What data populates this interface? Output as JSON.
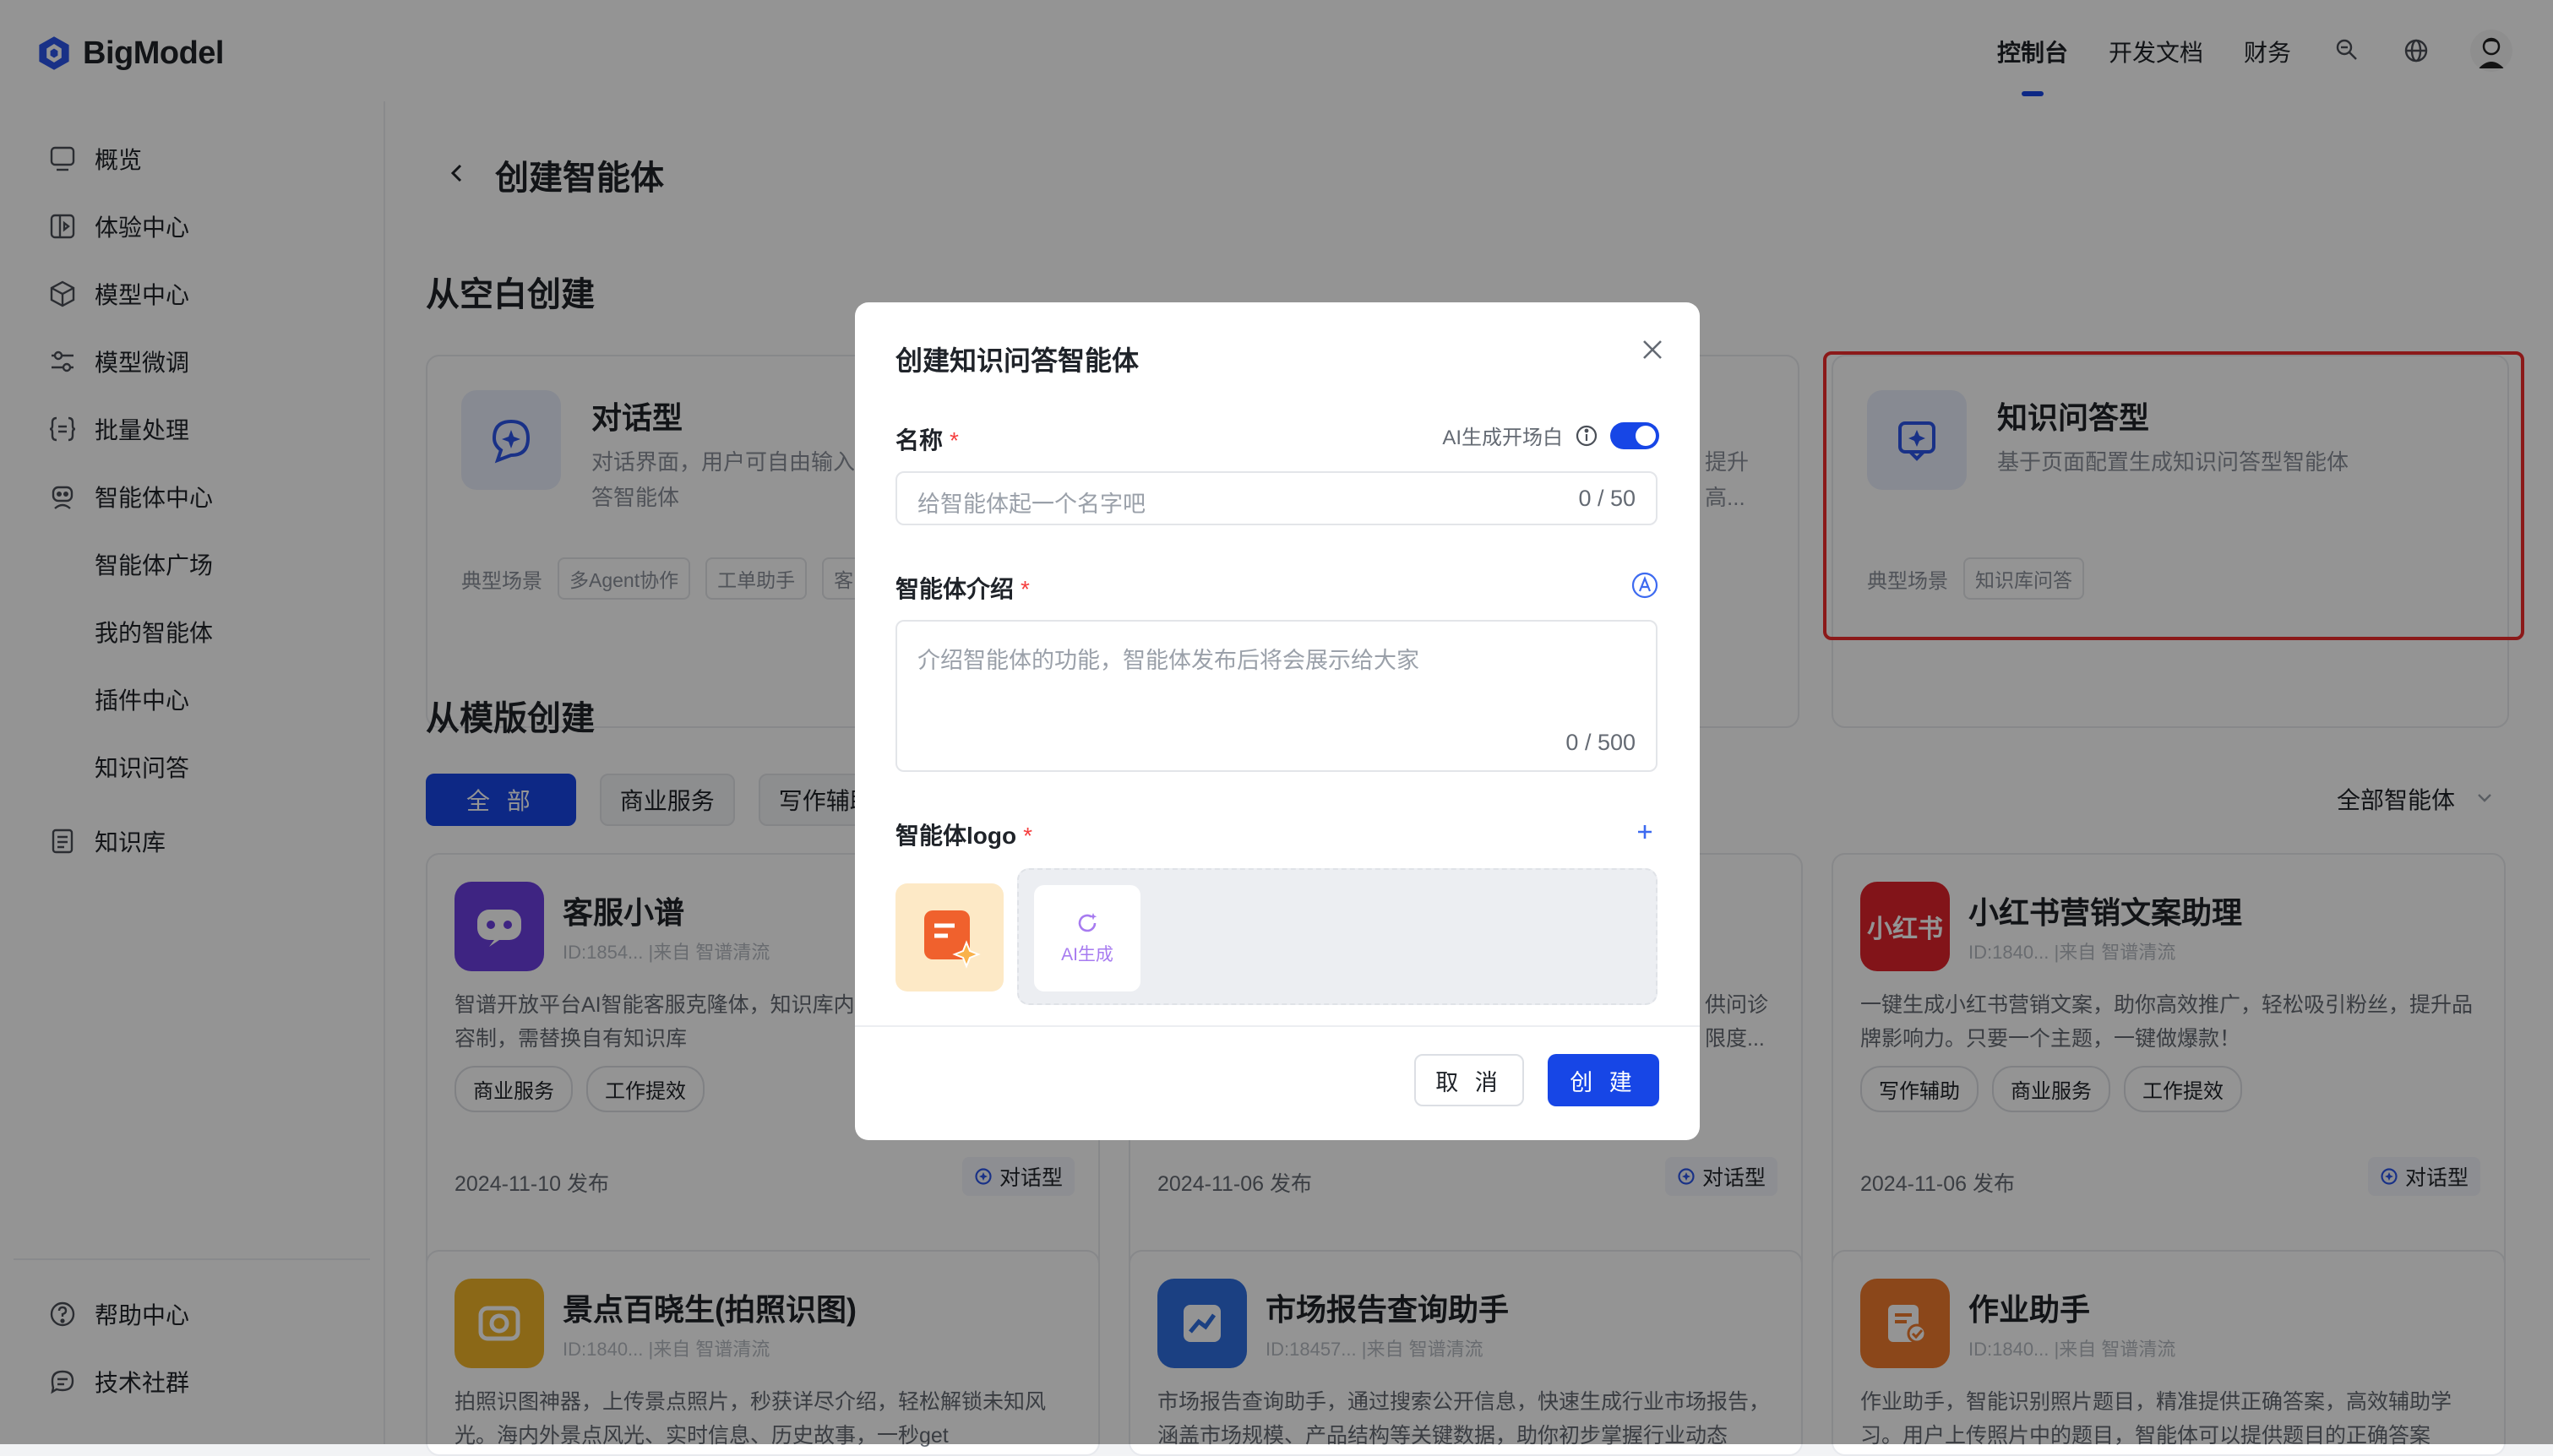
{
  "app": {
    "logo_text": "BigModel"
  },
  "topnav": {
    "items": [
      "控制台",
      "开发文档",
      "财务"
    ],
    "icons": [
      "service-icon",
      "globe-icon",
      "user-avatar"
    ]
  },
  "sidebar": {
    "items": [
      {
        "label": "概览",
        "icon": "overview-icon"
      },
      {
        "label": "体验中心",
        "icon": "experience-icon"
      },
      {
        "label": "模型中心",
        "icon": "cube-icon"
      },
      {
        "label": "模型微调",
        "icon": "sliders-icon"
      },
      {
        "label": "批量处理",
        "icon": "braces-icon"
      },
      {
        "label": "智能体中心",
        "icon": "robot-icon"
      }
    ],
    "sub_items": [
      "智能体广场",
      "我的智能体",
      "插件中心",
      "知识问答"
    ],
    "knowledge": {
      "label": "知识库",
      "icon": "book-icon"
    },
    "bottom": [
      {
        "label": "帮助中心",
        "icon": "help-icon"
      },
      {
        "label": "技术社群",
        "icon": "chat-icon"
      }
    ]
  },
  "page": {
    "title": "创建智能体",
    "blank_section": "从空白创建",
    "template_section": "从模版创建"
  },
  "blank_cards": [
    {
      "title": "对话型",
      "desc": "对话界面，用户可自由输入问答智能体",
      "scene_label": "典型场景",
      "tags": [
        "多Agent协作",
        "工单助手",
        "客"
      ]
    },
    {
      "title": "",
      "desc": "提升高...",
      "scene_label": "",
      "tags": []
    },
    {
      "title": "知识问答型",
      "desc": "基于页面配置生成知识问答型智能体",
      "scene_label": "典型场景",
      "tags": [
        "知识库问答"
      ]
    }
  ],
  "filters": [
    "全 部",
    "商业服务",
    "写作辅助"
  ],
  "all_agents": "全部智能体",
  "templates": [
    {
      "title": "客服小谱",
      "meta": "ID:1854... |来自 智谱清流",
      "desc": "智谱开放平台AI智能客服克隆体，知识库内容制，需替换自有知识库",
      "tags": [
        "商业服务",
        "工作提效"
      ],
      "date": "2024-11-10 发布",
      "type": "对话型",
      "color": "#6c3fe0"
    },
    {
      "title": "",
      "meta": "",
      "desc": "供问诊限度...",
      "tags": [],
      "date": "2024-11-06 发布",
      "type": "对话型",
      "color": "#ffffff"
    },
    {
      "title": "小红书营销文案助理",
      "meta": "ID:1840... |来自 智谱清流",
      "desc": "一键生成小红书营销文案，助你高效推广，轻松吸引粉丝，提升品牌影响力。只要一个主题，一键做爆款！",
      "tags": [
        "写作辅助",
        "商业服务",
        "工作提效"
      ],
      "date": "2024-11-06 发布",
      "type": "对话型",
      "color": "#e0242b",
      "icon_text": "小红书"
    },
    {
      "title": "景点百晓生(拍照识图)",
      "meta": "ID:1840... |来自 智谱清流",
      "desc": "拍照识图神器，上传景点照片，秒获详尽介绍，轻松解锁未知风光。海内外景点风光、实时信息、历史故事，一秒get",
      "color": "#f0b429"
    },
    {
      "title": "市场报告查询助手",
      "meta": "ID:18457... |来自 智谱清流",
      "desc": "市场报告查询助手，通过搜索公开信息，快速生成行业市场报告，涵盖市场规模、产品结构等关键数据，助你初步掌握行业动态",
      "color": "#2f6fe0"
    },
    {
      "title": "作业助手",
      "meta": "ID:1840... |来自 智谱清流",
      "desc": "作业助手，智能识别照片题目，精准提供正确答案，高效辅助学习。用户上传照片中的题目，智能体可以提供题目的正确答案",
      "color": "#f07a2e"
    }
  ],
  "modal": {
    "title": "创建知识问答智能体",
    "name_label": "名称",
    "required_mark": "*",
    "ai_opening_label": "AI生成开场白",
    "name_placeholder": "给智能体起一个名字吧",
    "name_counter": "0 / 50",
    "intro_label": "智能体介绍",
    "intro_placeholder": "介绍智能体的功能，智能体发布后将会展示给大家",
    "intro_counter": "0 / 500",
    "logo_label": "智能体logo",
    "ai_generate_label": "AI生成",
    "cancel": "取 消",
    "create": "创 建"
  },
  "colors": {
    "accent": "#1746e6",
    "highlight": "#ef2b2b",
    "required": "#f53f3f"
  }
}
